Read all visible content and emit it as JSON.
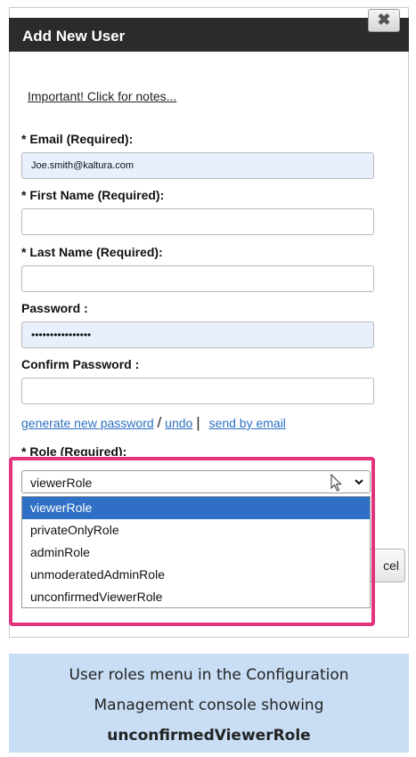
{
  "dialog": {
    "title": "Add New User",
    "close_glyph": "✖",
    "notes_link": "Important! Click for notes..."
  },
  "fields": {
    "email_label": "* Email (Required):",
    "email_value": "Joe.smith@kaltura.com",
    "first_name_label": "* First Name (Required):",
    "first_name_value": "",
    "last_name_label": "* Last Name (Required):",
    "last_name_value": "",
    "password_label": "Password :",
    "password_value": "••••••••••••••••",
    "confirm_password_label": "Confirm Password :",
    "confirm_password_value": ""
  },
  "password_links": {
    "generate": "generate new password",
    "slash": "/",
    "undo": "undo",
    "pipe": "|",
    "send": "send by email"
  },
  "role": {
    "label": "* Role (Required):",
    "selected": "viewerRole",
    "options": [
      "viewerRole",
      "privateOnlyRole",
      "adminRole",
      "unmoderatedAdminRole",
      "unconfirmedViewerRole"
    ]
  },
  "footer": {
    "cancel_partial": "cel"
  },
  "caption": {
    "line1": "User roles menu in the Configuration",
    "line2": "Management console showing",
    "line3": "unconfirmedViewerRole"
  },
  "icons": {
    "close": "close-icon",
    "cursor": "mouse-cursor-icon",
    "chevron": "chevron-down-icon"
  },
  "colors": {
    "title_bar": "#2b2b2b",
    "link_blue": "#2b6fc0",
    "selected_option": "#2f6fc5",
    "highlight": "#e2337c",
    "caption_bg": "#c9def5",
    "autofill_bg": "#e8f0fe"
  }
}
